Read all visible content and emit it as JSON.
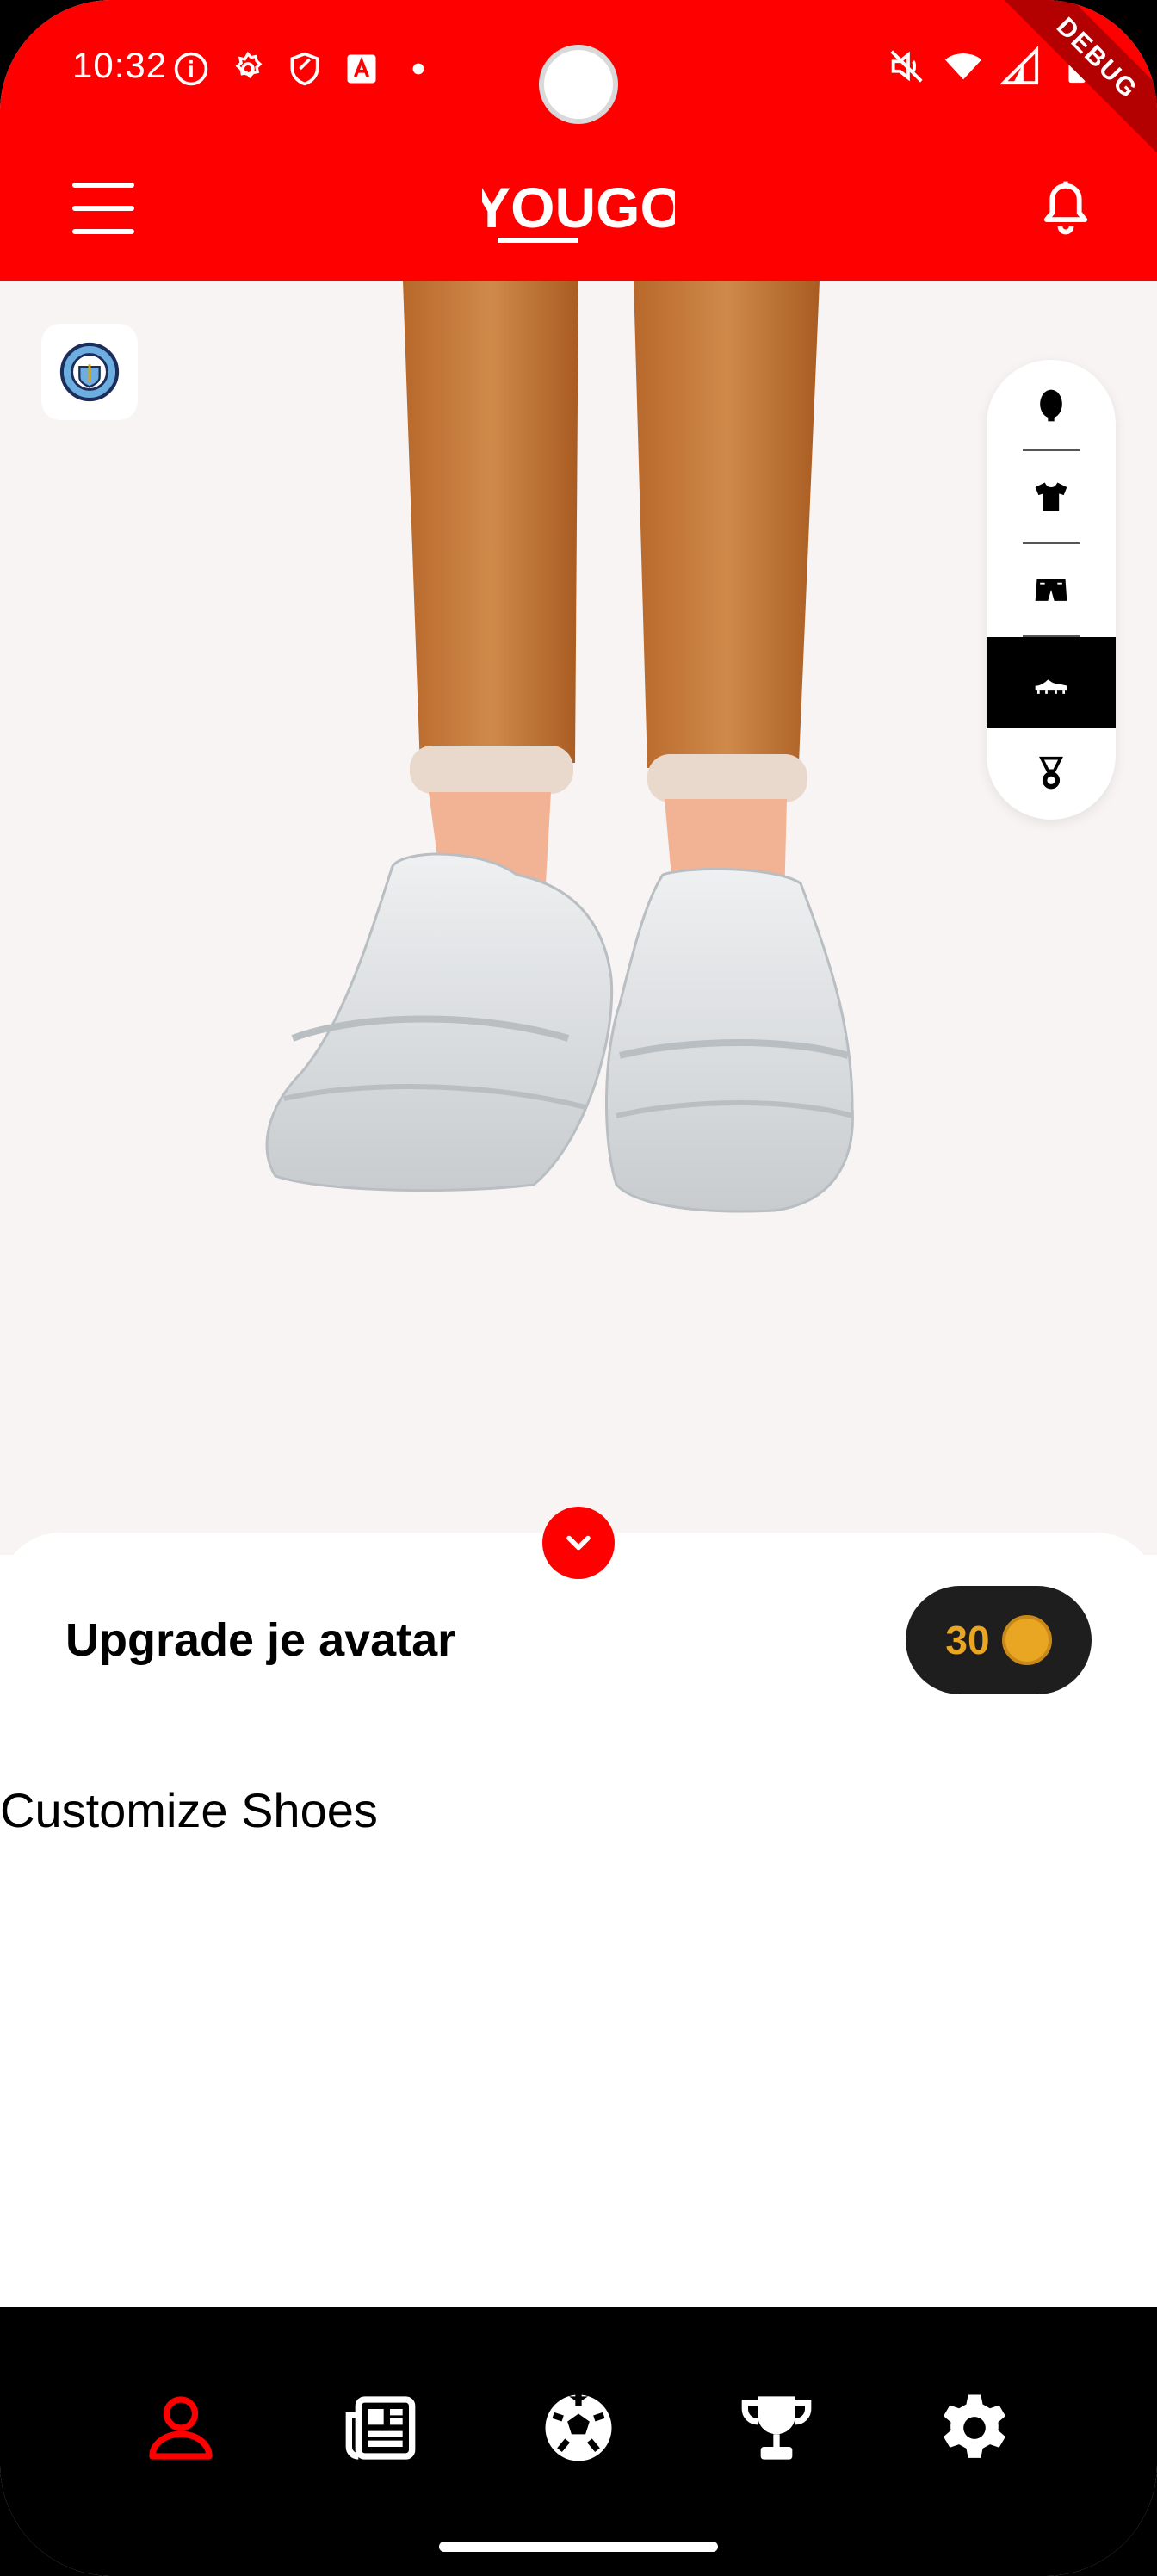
{
  "status_bar": {
    "time": "10:32",
    "left_icons": [
      "info-icon",
      "settings-icon",
      "shield-icon",
      "a-icon",
      "dot-icon"
    ],
    "right_icons": [
      "mute-icon",
      "wifi-icon",
      "signal-icon",
      "battery-icon"
    ],
    "debug_label": "DEBUG"
  },
  "header": {
    "logo_text": "YOUGO",
    "menu_icon": "hamburger-icon",
    "notifications_icon": "bell-icon",
    "background_color": "#ff0000"
  },
  "preview": {
    "club_badge_icon": "club-crest-icon",
    "categories": [
      {
        "id": "head",
        "icon": "head-icon",
        "active": false
      },
      {
        "id": "shirt",
        "icon": "shirt-icon",
        "active": false
      },
      {
        "id": "shorts",
        "icon": "shorts-icon",
        "active": false
      },
      {
        "id": "shoes",
        "icon": "shoe-icon",
        "active": true
      },
      {
        "id": "medal",
        "icon": "medal-icon",
        "active": false
      }
    ]
  },
  "sheet": {
    "title": "Upgrade je avatar",
    "coins": "30",
    "section_title": "Customize Shoes"
  },
  "bottom_nav": {
    "items": [
      {
        "id": "profile",
        "icon": "user-icon",
        "active": true
      },
      {
        "id": "news",
        "icon": "newspaper-icon",
        "active": false
      },
      {
        "id": "matches",
        "icon": "soccer-ball-icon",
        "active": false
      },
      {
        "id": "trophies",
        "icon": "trophy-icon",
        "active": false
      },
      {
        "id": "settings",
        "icon": "gear-icon",
        "active": false
      }
    ],
    "active_color": "#ff0000"
  }
}
